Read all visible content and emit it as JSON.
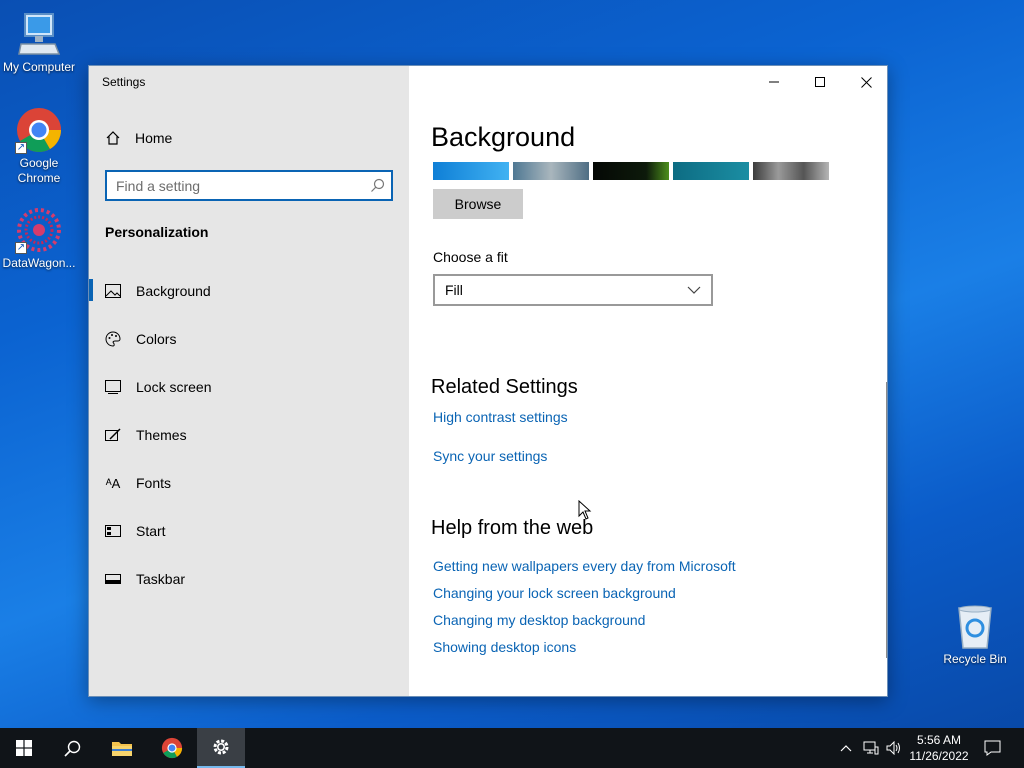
{
  "desktop": {
    "icons": [
      {
        "label": "My Computer"
      },
      {
        "label": "Google Chrome"
      },
      {
        "label": "DataWagon..."
      },
      {
        "label": "Recycle Bin"
      }
    ]
  },
  "window": {
    "title": "Settings",
    "controls": {
      "minimize": "minimize-icon",
      "maximize": "maximize-icon",
      "close": "close-icon"
    }
  },
  "sidebar": {
    "home_label": "Home",
    "search_placeholder": "Find a setting",
    "section_title": "Personalization",
    "items": [
      {
        "label": "Background",
        "icon": "picture-icon",
        "active": true
      },
      {
        "label": "Colors",
        "icon": "palette-icon"
      },
      {
        "label": "Lock screen",
        "icon": "lock-screen-icon"
      },
      {
        "label": "Themes",
        "icon": "themes-icon"
      },
      {
        "label": "Fonts",
        "icon": "fonts-icon"
      },
      {
        "label": "Start",
        "icon": "start-icon"
      },
      {
        "label": "Taskbar",
        "icon": "taskbar-icon"
      }
    ]
  },
  "content": {
    "title": "Background",
    "thumbnail_colors": [
      "#1d8fe0",
      "#6d8fa2",
      "#0b1a0b",
      "#137a8e",
      "#6f6f6f"
    ],
    "browse_label": "Browse",
    "fit_label": "Choose a fit",
    "fit_value": "Fill",
    "related_title": "Related Settings",
    "related_links": [
      "High contrast settings",
      "Sync your settings"
    ],
    "help_title": "Help from the web",
    "help_links": [
      "Getting new wallpapers every day from Microsoft",
      "Changing your lock screen background",
      "Changing my desktop background",
      "Showing desktop icons"
    ]
  },
  "taskbar": {
    "time": "5:56 AM",
    "date": "11/26/2022",
    "accent": "#76b9ed"
  }
}
